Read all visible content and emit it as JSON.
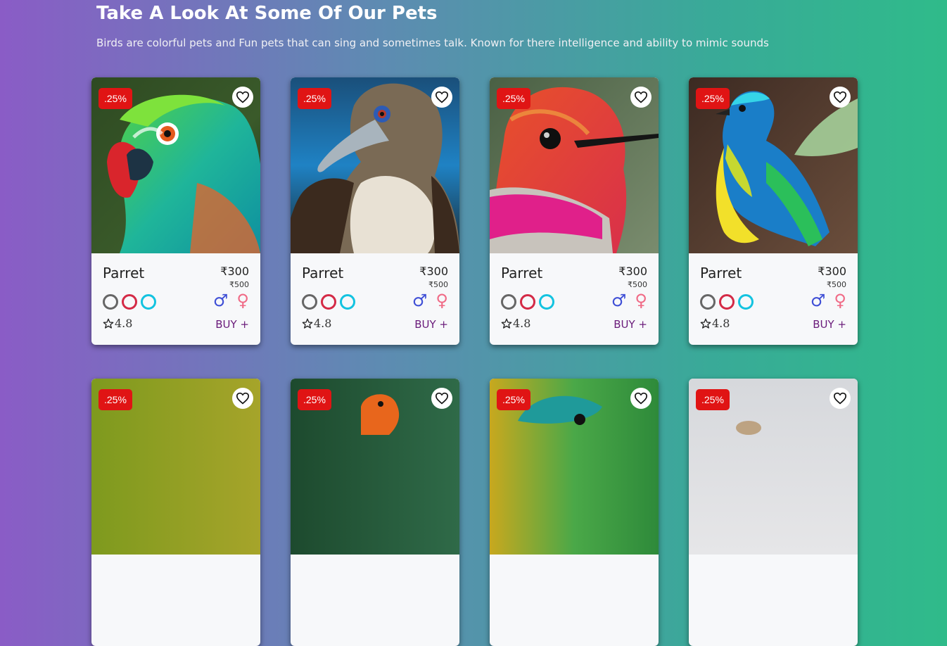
{
  "header": {
    "title": "Take A Look At Some Of Our Pets",
    "subtitle": "Birds are colorful pets and Fun pets that can sing and sometimes talk. Known for there intelligence and ability to mimic sounds"
  },
  "colors": {
    "discount_badge": "#e01414",
    "buy_link": "#6a1b7a",
    "swatch_colors": [
      "#666666",
      "#d42a46",
      "#13c3e0"
    ],
    "male": "#3f4fd6",
    "female": "#f06a86"
  },
  "cards": [
    {
      "discount": ".25%",
      "name": "Parret",
      "price": "₹300",
      "old_price": "₹500",
      "rating": "4.8",
      "buy_label": "BUY +",
      "image": "green-parrot-image"
    },
    {
      "discount": ".25%",
      "name": "Parret",
      "price": "₹300",
      "old_price": "₹500",
      "rating": "4.8",
      "buy_label": "BUY +",
      "image": "booby-bird-image"
    },
    {
      "discount": ".25%",
      "name": "Parret",
      "price": "₹300",
      "old_price": "₹500",
      "rating": "4.8",
      "buy_label": "BUY +",
      "image": "hummingbird-image"
    },
    {
      "discount": ".25%",
      "name": "Parret",
      "price": "₹300",
      "old_price": "₹500",
      "rating": "4.8",
      "buy_label": "BUY +",
      "image": "blue-yellow-bird-image"
    },
    {
      "discount": ".25%",
      "image": "olive-bird-image"
    },
    {
      "discount": ".25%",
      "image": "orange-parrot-image"
    },
    {
      "discount": ".25%",
      "image": "teal-bird-image"
    },
    {
      "discount": ".25%",
      "image": "white-bird-image"
    }
  ]
}
